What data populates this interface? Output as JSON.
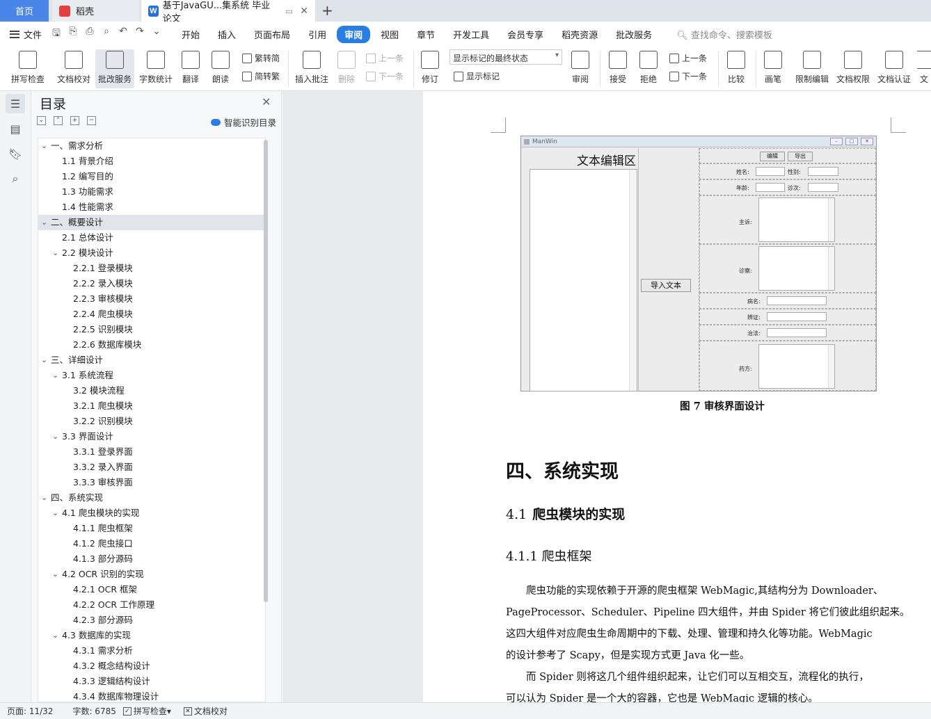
{
  "tabs": {
    "home": "首页",
    "daoke": "稻壳",
    "doc_title": "基于JavaGU...集系统 毕业论文",
    "new_tab": "+"
  },
  "menu": {
    "file": "文件",
    "items": [
      "开始",
      "插入",
      "页面布局",
      "引用",
      "审阅",
      "视图",
      "章节",
      "开发工具",
      "会员专享",
      "稻壳资源",
      "批改服务"
    ],
    "active": "审阅",
    "search": "查找命令、搜索模板"
  },
  "ribbon": {
    "spellcheck": "拼写检查",
    "proofread": "文档校对",
    "review_service": "批改服务",
    "wordcount": "字数统计",
    "translate": "翻译",
    "read_aloud": "朗读",
    "to_traditional": "繁转简",
    "to_simplified": "简转繁",
    "insert_comment": "插入批注",
    "delete": "删除",
    "prev_comment": "上一条",
    "next_comment": "下一条",
    "revise": "修订",
    "markup_select": "显示标记的最终状态",
    "show_markup": "显示标记",
    "review_pane": "审阅",
    "accept": "接受",
    "reject": "拒绝",
    "prev_change": "上一条",
    "next_change": "下一条",
    "compare": "比较",
    "pen": "画笔",
    "restrict_edit": "限制编辑",
    "doc_permission": "文档权限",
    "doc_cert": "文档认证",
    "more": "文"
  },
  "toc": {
    "title": "目录",
    "smart": "智能识别目录",
    "items": [
      {
        "label": "一、需求分析",
        "level": 1,
        "expanded": true
      },
      {
        "label": "1.1  背景介绍",
        "level": 2
      },
      {
        "label": "1.2  编写目的",
        "level": 2
      },
      {
        "label": "1.3  功能需求",
        "level": 2
      },
      {
        "label": "1.4  性能需求",
        "level": 2
      },
      {
        "label": "二、概要设计",
        "level": 1,
        "expanded": true,
        "selected": true
      },
      {
        "label": "2.1  总体设计",
        "level": 2
      },
      {
        "label": "2.2  模块设计",
        "level": 2,
        "expanded": true
      },
      {
        "label": "2.2.1  登录模块",
        "level": 3
      },
      {
        "label": "2.2.2  录入模块",
        "level": 3
      },
      {
        "label": "2.2.3  审核模块",
        "level": 3
      },
      {
        "label": "2.2.4  爬虫模块",
        "level": 3
      },
      {
        "label": "2.2.5  识别模块",
        "level": 3
      },
      {
        "label": "2.2.6  数据库模块",
        "level": 3
      },
      {
        "label": "三、详细设计",
        "level": 1,
        "expanded": true
      },
      {
        "label": "3.1  系统流程",
        "level": 2,
        "expanded": true
      },
      {
        "label": "3.2  模块流程",
        "level": 3
      },
      {
        "label": "3.2.1  爬虫模块",
        "level": 3
      },
      {
        "label": "3.2.2  识别模块",
        "level": 3
      },
      {
        "label": "3.3  界面设计",
        "level": 2,
        "expanded": true
      },
      {
        "label": "3.3.1  登录界面",
        "level": 3
      },
      {
        "label": "3.3.2  录入界面",
        "level": 3
      },
      {
        "label": "3.3.3  审核界面",
        "level": 3
      },
      {
        "label": "四、系统实现",
        "level": 1,
        "expanded": true
      },
      {
        "label": "4.1  爬虫模块的实现",
        "level": 2,
        "expanded": true
      },
      {
        "label": "4.1.1  爬虫框架",
        "level": 3
      },
      {
        "label": "4.1.2  爬虫接口",
        "level": 3
      },
      {
        "label": "4.1.3  部分源码",
        "level": 3
      },
      {
        "label": "4.2 OCR 识别的实现",
        "level": 2,
        "expanded": true
      },
      {
        "label": "4.2.1 OCR 框架",
        "level": 3
      },
      {
        "label": "4.2.2 OCR 工作原理",
        "level": 3
      },
      {
        "label": "4.2.3  部分源码",
        "level": 3
      },
      {
        "label": "4.3  数据库的实现",
        "level": 2,
        "expanded": true
      },
      {
        "label": "4.3.1  需求分析",
        "level": 3
      },
      {
        "label": "4.3.2 概念结构设计",
        "level": 3
      },
      {
        "label": "4.3.3 逻辑结构设计",
        "level": 3
      },
      {
        "label": "4.3.4 数据库物理设计",
        "level": 3
      }
    ]
  },
  "figure": {
    "window_title": "ManWin",
    "heading": "文本编辑区",
    "import_button": "导入文本",
    "edit_button": "编辑",
    "export_button": "导出",
    "name_label": "姓名:",
    "gender_label": "性别:",
    "age_label": "年龄:",
    "visit_label": "诊次:",
    "complaint_label": "主诉:",
    "diagnosis_label": "诊察:",
    "disease_label": "病名:",
    "syndrome_label": "辨证:",
    "treatment_label": "治法:",
    "prescription_label": "药方:"
  },
  "document": {
    "caption": "图 7  审核界面设计",
    "h1": "四、系统实现",
    "h2_num": "4.1",
    "h2_text": "爬虫模块的实现",
    "h3": "4.1.1  爬虫框架",
    "para_lines": [
      "　　爬虫功能的实现依赖于开源的爬虫框架 WebMagic,其结构分为 Downloader、",
      "PageProcessor、Scheduler、Pipeline 四大组件，并由 Spider 将它们彼此组织起来。",
      "这四大组件对应爬虫生命周期中的下载、处理、管理和持久化等功能。WebMagic",
      "的设计参考了 Scapy，但是实现方式更 Java 化一些。",
      "　　而 Spider 则将这几个组件组织起来，让它们可以互相交互，流程化的执行，",
      "可以认为 Spider 是一个大的容器，它也是 WebMagic 逻辑的核心。"
    ]
  },
  "status": {
    "page": "页面: 11/32",
    "words": "字数: 6785",
    "spellcheck": "拼写检查",
    "proofread": "文档校对"
  }
}
